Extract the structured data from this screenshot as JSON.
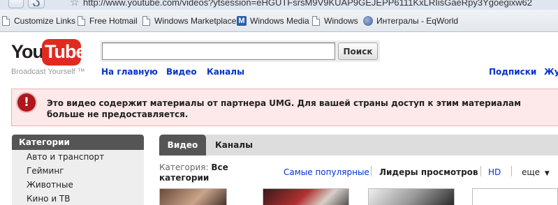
{
  "browser": {
    "url": "http://www.youtube.com/videos?ytsession=eHGUTFsrsM9V9KUAP9GEJEPP6111KxLRIisGaeRpy3Ygoegixw62"
  },
  "bookmarks": [
    {
      "label": "Customize Links",
      "icon": "page-icon"
    },
    {
      "label": "Free Hotmail",
      "icon": "page-icon"
    },
    {
      "label": "Windows Marketplace",
      "icon": "page-icon"
    },
    {
      "label": "Windows Media",
      "icon": "msn-icon"
    },
    {
      "label": "Windows",
      "icon": "page-icon"
    },
    {
      "label": "Интегралы - EqWorld",
      "icon": "globe-icon"
    }
  ],
  "header": {
    "logo_you": "You",
    "logo_tube": "Tube",
    "slogan": "Broadcast Yourself ™",
    "search_value": "",
    "search_button": "Поиск",
    "nav": [
      "На главную",
      "Видео",
      "Каналы"
    ],
    "right_nav": [
      "Подписки",
      "Жу"
    ]
  },
  "alert": {
    "icon": "exclamation-icon",
    "text": "Это видео содержит материалы от партнера UMG. Для вашей страны доступ к этим материалам больше не предоставляется."
  },
  "sidebar": {
    "title": "Категории",
    "items": [
      "Авто и транспорт",
      "Гейминг",
      "Животные",
      "Кино и ТВ"
    ]
  },
  "tabs": {
    "active": "Видео",
    "other": "Каналы"
  },
  "filters": {
    "category_label": "Категория:",
    "category_value": "Все категории",
    "sort": [
      "Самые популярные",
      "Лидеры просмотров",
      "HD",
      "еще"
    ]
  },
  "colors": {
    "link": "#0033cc",
    "alert_bg": "#fde9e9",
    "alert_icon": "#b0161a",
    "brand_red": "#e02a20"
  }
}
